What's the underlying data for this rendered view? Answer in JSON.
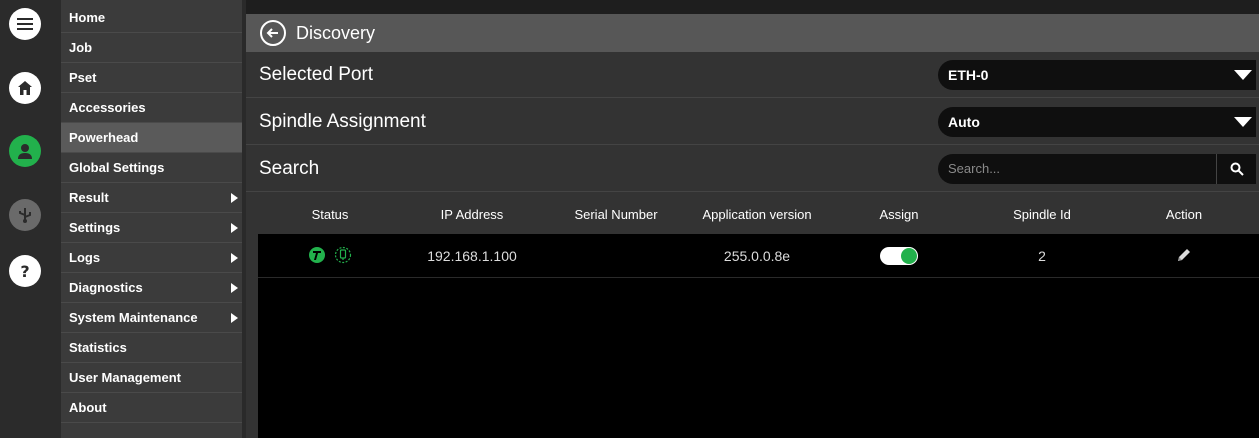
{
  "colors": {
    "accent_green": "#22b14c",
    "background": "#1e1e1e",
    "panel": "#333333",
    "titlebar": "#575757"
  },
  "rail": {
    "icons": [
      "menu-icon",
      "home-icon",
      "user-icon",
      "usb-icon",
      "help-icon"
    ]
  },
  "menu": {
    "items": [
      {
        "label": "Home",
        "has_submenu": false
      },
      {
        "label": "Job",
        "has_submenu": false
      },
      {
        "label": "Pset",
        "has_submenu": false
      },
      {
        "label": "Accessories",
        "has_submenu": false
      },
      {
        "label": "Powerhead",
        "has_submenu": false,
        "active": true
      },
      {
        "label": "Global Settings",
        "has_submenu": false
      },
      {
        "label": "Result",
        "has_submenu": true
      },
      {
        "label": "Settings",
        "has_submenu": true
      },
      {
        "label": "Logs",
        "has_submenu": true
      },
      {
        "label": "Diagnostics",
        "has_submenu": true
      },
      {
        "label": "System Maintenance",
        "has_submenu": true
      },
      {
        "label": "Statistics",
        "has_submenu": false
      },
      {
        "label": "User Management",
        "has_submenu": false
      },
      {
        "label": "About",
        "has_submenu": false
      }
    ]
  },
  "header": {
    "title": "Discovery",
    "back_icon": "back-arrow-icon"
  },
  "selected_port": {
    "label": "Selected Port",
    "value": "ETH-0"
  },
  "spindle_assignment": {
    "label": "Spindle Assignment",
    "value": "Auto"
  },
  "search": {
    "label": "Search",
    "placeholder": "Search...",
    "value": ""
  },
  "table": {
    "columns": [
      "Status",
      "IP Address",
      "Serial Number",
      "Application version",
      "Assign",
      "Spindle Id",
      "Action"
    ],
    "rows": [
      {
        "status_icons": [
          "tool-status-icon",
          "spindle-status-icon"
        ],
        "ip_address": "192.168.1.100",
        "serial_number": "",
        "application_version": "255.0.0.8e",
        "assign": true,
        "spindle_id": "2",
        "action_icon": "edit-pencil-icon"
      }
    ]
  }
}
